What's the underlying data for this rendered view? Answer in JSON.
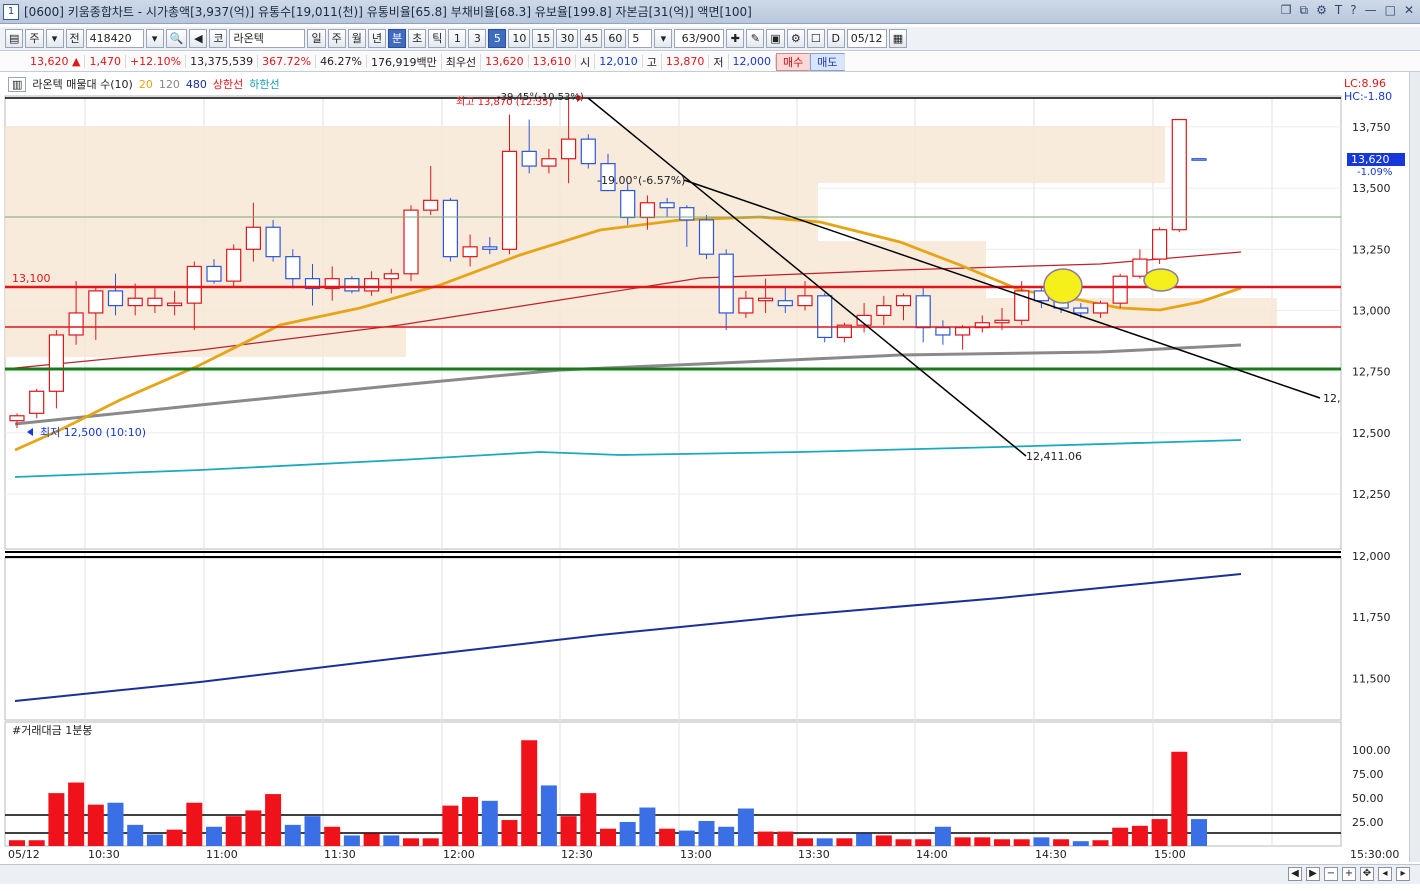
{
  "window": {
    "num": "1",
    "title": "[0600] 키움종합차트 - 시가총액[3,937(억)] 유통수[19,011(천)] 유통비율[65.8] 부채비율[68.3] 유보율[199.8] 자본금[31(억)] 액면[100]"
  },
  "toolbar": {
    "period": "주",
    "scope": "전",
    "code": "418420",
    "market": "코",
    "name": "라온텍",
    "tabs": [
      "일",
      "주",
      "월",
      "년",
      "분",
      "초",
      "틱"
    ],
    "active_tab": "분",
    "intervals": [
      "1",
      "3",
      "5",
      "10",
      "15",
      "30",
      "45",
      "60"
    ],
    "active_interval": "5",
    "interval_select": "5",
    "count": "63/900",
    "date": "05/12",
    "d_label": "D"
  },
  "quote": {
    "price": "13,620 ▲",
    "change": "1,470",
    "change_pct": "+12.10%",
    "volume": "13,375,539",
    "vol_ratio": "367.72%",
    "rate2": "46.27%",
    "amount": "176,919백만",
    "best_label": "최우선",
    "ask": "13,620",
    "bid": "13,610",
    "open_label": "시",
    "open": "12,010",
    "high_label": "고",
    "high": "13,870",
    "low_label": "저",
    "low": "12,000",
    "buy": "매수",
    "sell": "매도"
  },
  "legend": {
    "title": "라온텍 매물대 수(10)",
    "ma20": "20",
    "ma120": "120",
    "ma480": "480",
    "upper": "상한선",
    "lower": "하한선"
  },
  "labels": {
    "lc": "LC:8.96",
    "hc": "HC:-1.80",
    "level_13100": "13,100",
    "high_note": "최고 13,870 (12:35)",
    "angle1": "-39.45°(-10.53%)",
    "angle2": "-19.00°(-6.57%)",
    "low_note": "최저 12,500 (10:10)",
    "trend_end1": "12,411.06",
    "trend_end2": "12,",
    "cur_price": "13,620",
    "cur_pct": "-1.09%",
    "vol_title": "#거래대금 1분봉"
  },
  "chart_data": {
    "type": "candlestick",
    "price_axis_ticks": [
      "13,750",
      "13,500",
      "13,250",
      "13,000",
      "12,750",
      "12,500",
      "12,250",
      "12,000",
      "11,750",
      "11,500"
    ],
    "volume_axis_ticks": [
      "100.00",
      "75.00",
      "50.00",
      "25.00"
    ],
    "time_axis": [
      "05/12",
      "10:30",
      "11:00",
      "11:30",
      "12:00",
      "12:30",
      "13:00",
      "13:30",
      "14:00",
      "14:30",
      "15:00",
      "15:30:00"
    ],
    "candles": [
      [
        12550,
        12580,
        12520,
        12570,
        "u"
      ],
      [
        12580,
        12680,
        12560,
        12670,
        "u"
      ],
      [
        12670,
        12920,
        12600,
        12900,
        "u"
      ],
      [
        12900,
        13120,
        12860,
        12990,
        "u"
      ],
      [
        12990,
        13100,
        12880,
        13080,
        "u"
      ],
      [
        13080,
        13150,
        12980,
        13020,
        "d"
      ],
      [
        13020,
        13110,
        12980,
        13050,
        "u"
      ],
      [
        13050,
        13090,
        12990,
        13020,
        "u"
      ],
      [
        13020,
        13080,
        12980,
        13030,
        "u"
      ],
      [
        13030,
        13200,
        12920,
        13180,
        "u"
      ],
      [
        13180,
        13210,
        13110,
        13120,
        "d"
      ],
      [
        13120,
        13270,
        13100,
        13250,
        "u"
      ],
      [
        13250,
        13440,
        13200,
        13340,
        "u"
      ],
      [
        13340,
        13370,
        13200,
        13220,
        "d"
      ],
      [
        13220,
        13250,
        13090,
        13130,
        "d"
      ],
      [
        13130,
        13190,
        13020,
        13090,
        "d"
      ],
      [
        13090,
        13180,
        13040,
        13130,
        "u"
      ],
      [
        13130,
        13140,
        13070,
        13080,
        "d"
      ],
      [
        13080,
        13160,
        13060,
        13130,
        "u"
      ],
      [
        13130,
        13170,
        13070,
        13150,
        "u"
      ],
      [
        13150,
        13430,
        13120,
        13410,
        "u"
      ],
      [
        13410,
        13590,
        13390,
        13450,
        "u"
      ],
      [
        13450,
        13460,
        13200,
        13220,
        "d"
      ],
      [
        13220,
        13310,
        13180,
        13260,
        "u"
      ],
      [
        13260,
        13300,
        13230,
        13250,
        "d"
      ],
      [
        13250,
        13800,
        13230,
        13650,
        "u"
      ],
      [
        13650,
        13780,
        13560,
        13590,
        "d"
      ],
      [
        13590,
        13660,
        13560,
        13620,
        "u"
      ],
      [
        13620,
        13870,
        13520,
        13700,
        "u"
      ],
      [
        13700,
        13720,
        13580,
        13600,
        "d"
      ],
      [
        13600,
        13640,
        13500,
        13490,
        "d"
      ],
      [
        13490,
        13520,
        13350,
        13380,
        "d"
      ],
      [
        13380,
        13470,
        13330,
        13440,
        "u"
      ],
      [
        13440,
        13460,
        13380,
        13420,
        "d"
      ],
      [
        13420,
        13430,
        13260,
        13370,
        "d"
      ],
      [
        13370,
        13390,
        13210,
        13230,
        "d"
      ],
      [
        13230,
        13250,
        12920,
        12990,
        "d"
      ],
      [
        12990,
        13080,
        12970,
        13050,
        "u"
      ],
      [
        13050,
        13130,
        12990,
        13040,
        "u"
      ],
      [
        13040,
        13100,
        12990,
        13020,
        "d"
      ],
      [
        13020,
        13120,
        13000,
        13060,
        "u"
      ],
      [
        13060,
        13070,
        12870,
        12890,
        "d"
      ],
      [
        12890,
        12950,
        12870,
        12940,
        "u"
      ],
      [
        12940,
        13030,
        12910,
        12980,
        "u"
      ],
      [
        12980,
        13060,
        12940,
        13020,
        "u"
      ],
      [
        13020,
        13070,
        12960,
        13060,
        "u"
      ],
      [
        13060,
        13100,
        12870,
        12930,
        "d"
      ],
      [
        12930,
        12960,
        12860,
        12900,
        "d"
      ],
      [
        12900,
        12940,
        12840,
        12930,
        "u"
      ],
      [
        12930,
        12980,
        12910,
        12950,
        "u"
      ],
      [
        12950,
        13010,
        12920,
        12960,
        "u"
      ],
      [
        12960,
        13120,
        12940,
        13080,
        "u"
      ],
      [
        13080,
        13100,
        13010,
        13040,
        "d"
      ],
      [
        13040,
        13060,
        12990,
        13010,
        "d"
      ],
      [
        13010,
        13030,
        12970,
        12990,
        "d"
      ],
      [
        12990,
        13040,
        12970,
        13030,
        "u"
      ],
      [
        13030,
        13150,
        13010,
        13140,
        "u"
      ],
      [
        13140,
        13250,
        13130,
        13210,
        "u"
      ],
      [
        13210,
        13340,
        13190,
        13330,
        "u"
      ],
      [
        13330,
        13410,
        13320,
        13780,
        "u"
      ],
      [
        13620,
        13620,
        13620,
        13620,
        "n"
      ]
    ],
    "volumes": [
      [
        6,
        "r"
      ],
      [
        6,
        "r"
      ],
      [
        55,
        "r"
      ],
      [
        66,
        "r"
      ],
      [
        43,
        "r"
      ],
      [
        45,
        "b"
      ],
      [
        22,
        "b"
      ],
      [
        12,
        "b"
      ],
      [
        17,
        "r"
      ],
      [
        45,
        "r"
      ],
      [
        20,
        "b"
      ],
      [
        31,
        "r"
      ],
      [
        37,
        "r"
      ],
      [
        54,
        "r"
      ],
      [
        22,
        "b"
      ],
      [
        31,
        "b"
      ],
      [
        20,
        "r"
      ],
      [
        11,
        "b"
      ],
      [
        13,
        "r"
      ],
      [
        11,
        "b"
      ],
      [
        8,
        "r"
      ],
      [
        8,
        "r"
      ],
      [
        42,
        "r"
      ],
      [
        51,
        "r"
      ],
      [
        47,
        "b"
      ],
      [
        27,
        "r"
      ],
      [
        110,
        "r"
      ],
      [
        63,
        "b"
      ],
      [
        31,
        "r"
      ],
      [
        55,
        "r"
      ],
      [
        18,
        "r"
      ],
      [
        25,
        "b"
      ],
      [
        40,
        "b"
      ],
      [
        18,
        "r"
      ],
      [
        16,
        "b"
      ],
      [
        26,
        "b"
      ],
      [
        20,
        "b"
      ],
      [
        39,
        "b"
      ],
      [
        15,
        "r"
      ],
      [
        15,
        "r"
      ],
      [
        8,
        "r"
      ],
      [
        8,
        "b"
      ],
      [
        8,
        "r"
      ],
      [
        13,
        "b"
      ],
      [
        11,
        "r"
      ],
      [
        7,
        "r"
      ],
      [
        7,
        "r"
      ],
      [
        20,
        "b"
      ],
      [
        9,
        "r"
      ],
      [
        9,
        "r"
      ],
      [
        7,
        "r"
      ],
      [
        7,
        "r"
      ],
      [
        9,
        "b"
      ],
      [
        7,
        "r"
      ],
      [
        5,
        "b"
      ],
      [
        6,
        "r"
      ],
      [
        19,
        "r"
      ],
      [
        21,
        "r"
      ],
      [
        28,
        "r"
      ],
      [
        98,
        "r"
      ],
      [
        28,
        "b"
      ]
    ]
  },
  "bottom": {
    "scroll_left": "◀",
    "scroll_right": "▶"
  }
}
